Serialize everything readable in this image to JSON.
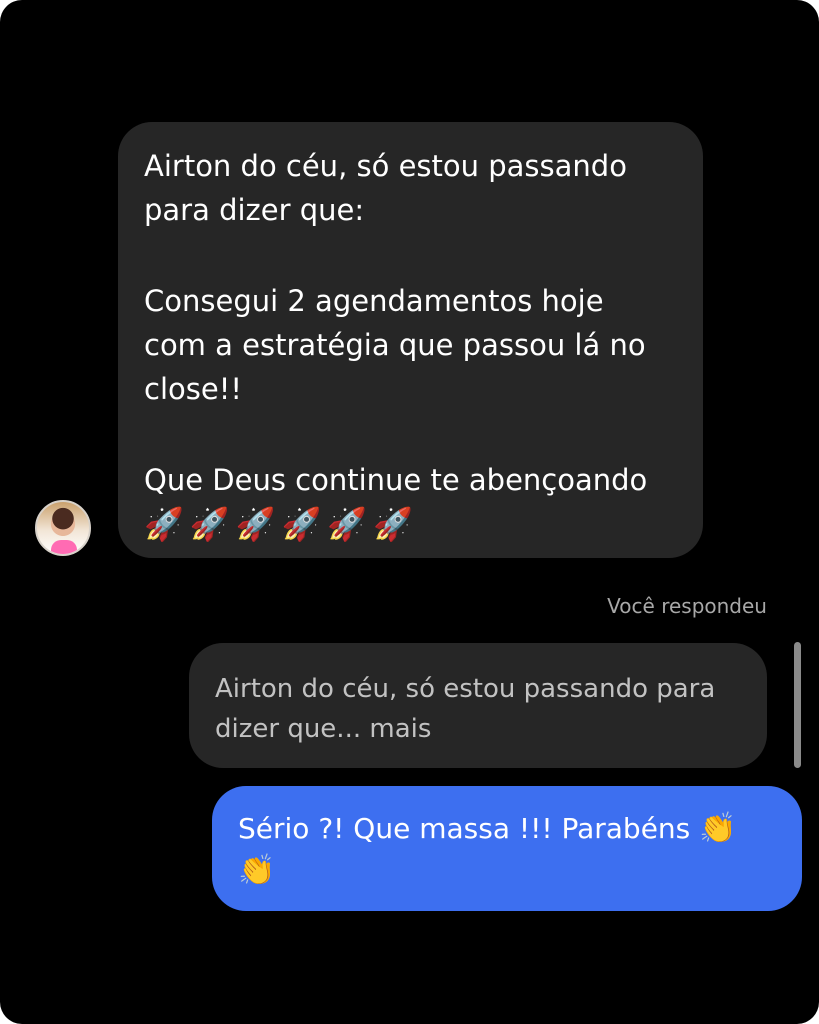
{
  "conversation": {
    "incoming_message": {
      "line_1": "Airton do céu, só estou passando",
      "line_2": "para dizer que:",
      "line_3": "Consegui 2 agendamentos hoje",
      "line_4": "com a estratégia que passou lá no",
      "line_5": "close!!",
      "line_6": "Que Deus continue te abençoando",
      "emojis": "🚀🚀🚀🚀🚀🚀"
    },
    "reply_status": "Você respondeu",
    "quoted_message": {
      "line_1": "Airton do céu, só estou passando para",
      "line_2": "dizer que... mais"
    },
    "outgoing_message": {
      "text": "Sério ?! Que massa !!! Parabéns",
      "emoji_1": "👏",
      "emoji_2": "👏"
    }
  },
  "icons": {
    "avatar": "profile-photo",
    "incoming_emoji": "rocket-emoji",
    "outgoing_emoji": "clapping-hands-emoji"
  },
  "colors": {
    "background": "#000000",
    "incoming_bubble": "#262626",
    "outgoing_bubble": "#3d6ff0",
    "meta_text": "#a8a8a8"
  }
}
